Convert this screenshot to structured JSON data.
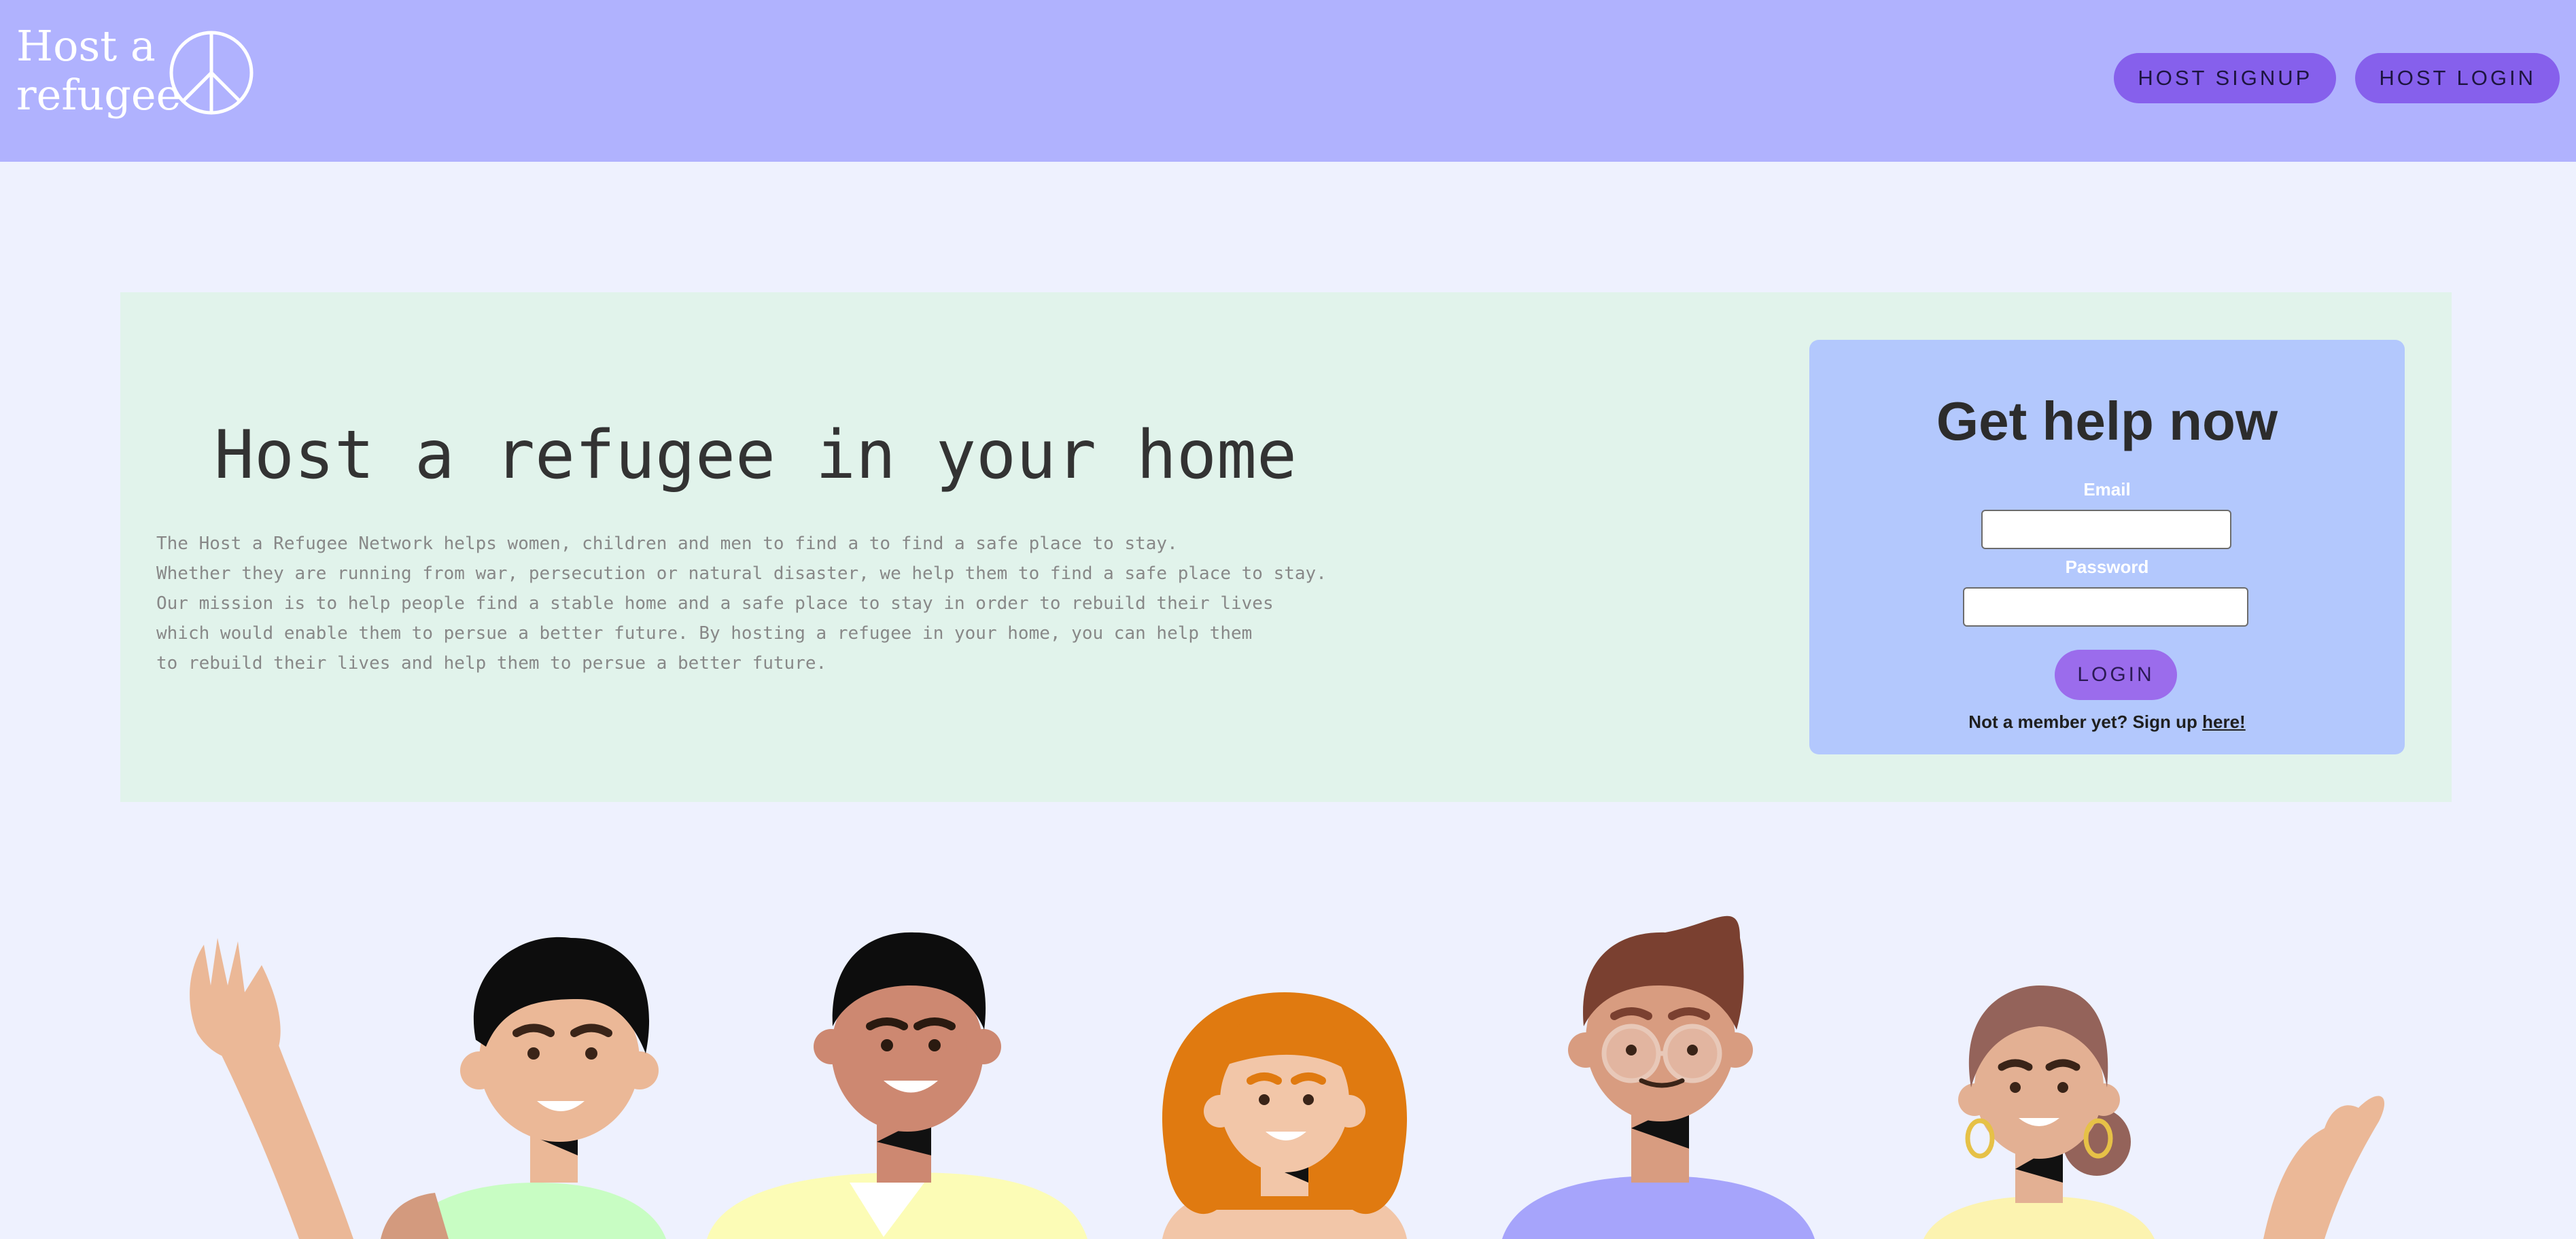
{
  "header": {
    "logo_line1": "Host a",
    "logo_line2": "refugee",
    "logo_icon": "peace-icon",
    "nav": {
      "signup_label": "HOST SIGNUP",
      "login_label": "HOST LOGIN"
    }
  },
  "hero": {
    "title": "Host a refugee in your home",
    "paragraph_lines": [
      "The Host a Refugee Network helps women, children and men to find a to find a safe place to stay.",
      "Whether they are running from war, persecution or natural disaster, we help them to find a safe place to stay.",
      "Our mission is to help people find a stable home and a safe place to stay in order to rebuild their lives",
      "which would enable them to persue a better future. By hosting a refugee in your home, you can help them",
      "to rebuild their lives and help them to persue a better future."
    ]
  },
  "login_card": {
    "title": "Get help now",
    "email_label": "Email",
    "email_value": "",
    "password_label": "Password",
    "password_value": "",
    "login_button": "LOGIN",
    "signup_prompt": "Not a member yet? Sign up ",
    "signup_link": "here!"
  },
  "colors": {
    "header_bg": "#b0b2fe",
    "page_bg": "#eef1fe",
    "hero_bg": "#e1f3eb",
    "card_bg": "#b3c8fd",
    "nav_button": "#8660ec",
    "login_button": "#9b6cec"
  }
}
